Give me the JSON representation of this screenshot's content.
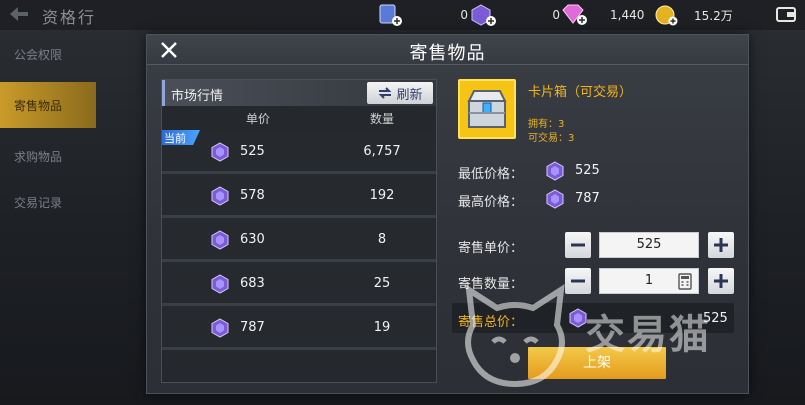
{
  "background": {
    "title": "资格行",
    "sidebar": [
      "公会权限",
      "寄售物品",
      "求购物品",
      "交易记录"
    ]
  },
  "resources": [
    {
      "icon": "card-plus-icon",
      "value": "0"
    },
    {
      "icon": "gem-plus-icon",
      "value": "0"
    },
    {
      "icon": "diamond-plus-icon",
      "value": "1,440"
    },
    {
      "icon": "gold-coin-plus-icon",
      "value": "15.2万"
    }
  ],
  "dialog": {
    "title": "寄售物品",
    "market": {
      "title": "市场行情",
      "refresh_label": "刷新",
      "col_price": "单价",
      "col_qty": "数量",
      "current_tag": "当前",
      "rows": [
        {
          "price": "525",
          "qty": "6,757"
        },
        {
          "price": "578",
          "qty": "192"
        },
        {
          "price": "630",
          "qty": "8"
        },
        {
          "price": "683",
          "qty": "25"
        },
        {
          "price": "787",
          "qty": "19"
        }
      ]
    },
    "item": {
      "name": "卡片箱（可交易）",
      "owned": "拥有：3",
      "tradable": "可交易：3"
    },
    "min_price_label": "最低价格：",
    "min_price": "525",
    "max_price_label": "最高价格：",
    "max_price": "787",
    "unit_price_label": "寄售单价：",
    "unit_price": "525",
    "quantity_label": "寄售数量：",
    "quantity": "1",
    "total_label": "寄售总价：",
    "total": "525",
    "list_button": "上架"
  },
  "watermark": "交易猫",
  "colors": {
    "accent_gold": "#f1b51c",
    "button_orange": "#e8a423",
    "gem_purple": "#7b5bd6"
  }
}
